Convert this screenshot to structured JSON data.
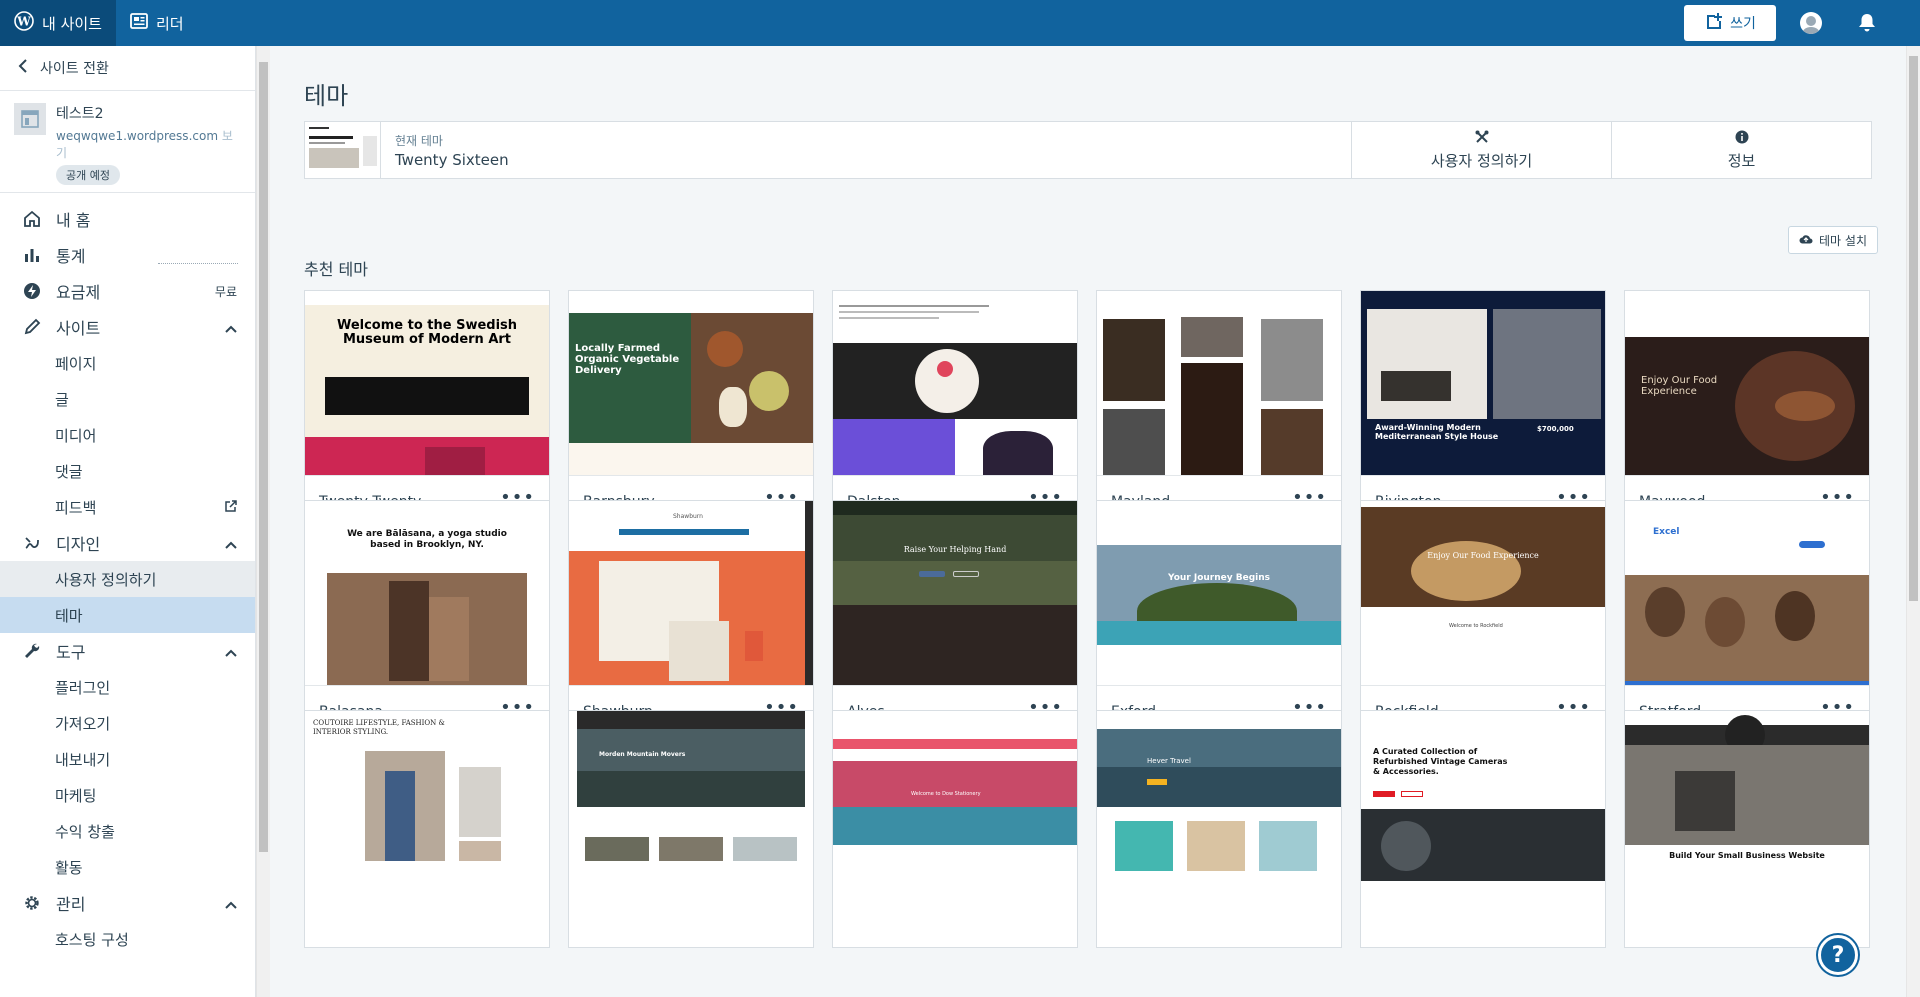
{
  "masterbar": {
    "my_site": "내 사이트",
    "reader": "리더",
    "write": "쓰기"
  },
  "sidebar": {
    "switch_site": "사이트 전환",
    "site_name": "테스트2",
    "site_url": "weqwqwe1.wordpress.com",
    "site_view": "보기",
    "site_badge": "공개 예정",
    "items": [
      {
        "label": "내 홈"
      },
      {
        "label": "통계"
      },
      {
        "label": "요금제",
        "right": "무료"
      },
      {
        "label": "사이트"
      },
      {
        "label": "디자인"
      },
      {
        "label": "도구"
      },
      {
        "label": "관리"
      }
    ],
    "site_sub": [
      "페이지",
      "글",
      "미디어",
      "댓글",
      "피드백"
    ],
    "design_sub": [
      "사용자 정의하기",
      "테마"
    ],
    "tools_sub": [
      "플러그인",
      "가져오기",
      "내보내기",
      "마케팅",
      "수익 창출",
      "활동"
    ],
    "manage_sub": [
      "호스팅 구성"
    ]
  },
  "main": {
    "title": "테마",
    "current_label": "현재 테마",
    "current_name": "Twenty Sixteen",
    "customize": "사용자 정의하기",
    "info": "정보",
    "install": "테마 설치",
    "recommended": "추천 테마"
  },
  "themes": [
    {
      "name": "Twenty Twenty",
      "headline": "Welcome to the Swedish Museum of Modern Art"
    },
    {
      "name": "Barnsbury",
      "headline": "Locally Farmed Organic Vegetable Delivery"
    },
    {
      "name": "Dalston",
      "headline": ""
    },
    {
      "name": "Mayland",
      "headline": ""
    },
    {
      "name": "Rivington",
      "headline": "Award-Winning Modern Mediterranean Style House"
    },
    {
      "name": "Maywood",
      "headline": "Enjoy Our Food Experience"
    },
    {
      "name": "Balasana",
      "headline": "We are Bālāsana, a yoga studio based in Brooklyn, NY."
    },
    {
      "name": "Shawburn",
      "headline": "Shawburn"
    },
    {
      "name": "Alves",
      "headline": "Raise Your Helping Hand"
    },
    {
      "name": "Exford",
      "headline": "Your Journey Begins"
    },
    {
      "name": "Rockfield",
      "headline": "Enjoy Our Food Experience"
    },
    {
      "name": "Stratford",
      "headline": "Excel"
    },
    {
      "name": "",
      "headline": "COUTOIRE LIFESTYLE, FASHION & INTERIOR STYLING."
    },
    {
      "name": "",
      "headline": "Morden Mountain Movers"
    },
    {
      "name": "",
      "headline": "Welcome to Dow Stationery"
    },
    {
      "name": "",
      "headline": "Hever Travel"
    },
    {
      "name": "",
      "headline": "A Curated Collection of Refurbished Vintage Cameras & Accessories."
    },
    {
      "name": "",
      "headline": "Build Your Small Business Website"
    }
  ],
  "colors": {
    "masterbar": "#11639e",
    "selected_nav": "#c6dcf0",
    "background": "#f3f6f8"
  }
}
